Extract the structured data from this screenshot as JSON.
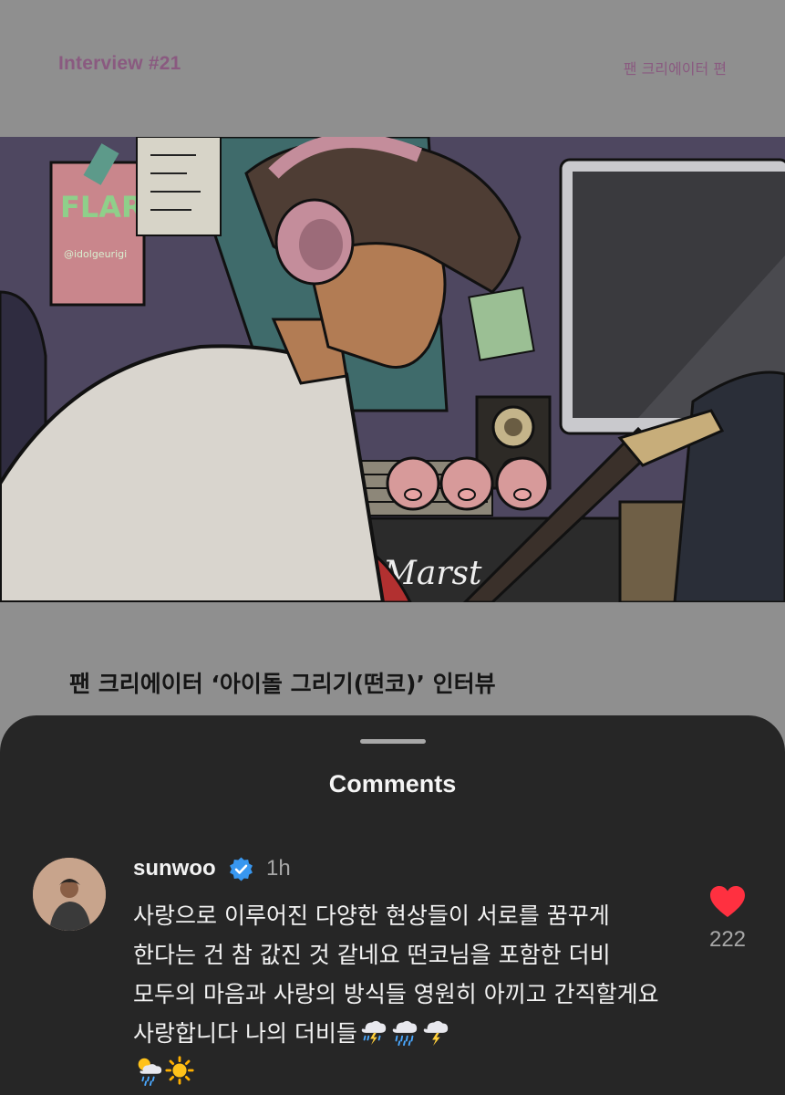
{
  "article": {
    "interview_label": "Interview #21",
    "series_tag": "팬 크리에이터 편",
    "title": "팬 크리에이터 ‘아이돌 그리기(떤코)’ 인터뷰",
    "hero_poster_text": "FLARE",
    "hero_poster_handle": "@idolgeurigi",
    "hero_amp_brand": "Marst"
  },
  "comments_sheet": {
    "title": "Comments",
    "comments": [
      {
        "username": "sunwoo",
        "verified": true,
        "time": "1h",
        "text": "사랑으로 이루어진 다양한 현상들이 서로를 꿈꾸게 한다는 건 참 값진 것 같네요 떤코님을 포함한 더비 모두의 마음과 사랑의 방식들 영원히 아끼고 간직할게요 사랑합니다 나의 더비들",
        "emoji_icons": [
          "thunder-rain-icon",
          "rain-icon",
          "thunder-cloud-icon",
          "sun-rain-icon",
          "sun-icon"
        ],
        "likes": "222",
        "liked": true
      }
    ]
  },
  "colors": {
    "accent_header": "#8a5a80",
    "sheet_bg": "#262626",
    "like_red": "#ff3040",
    "verified_blue": "#3897f0"
  }
}
